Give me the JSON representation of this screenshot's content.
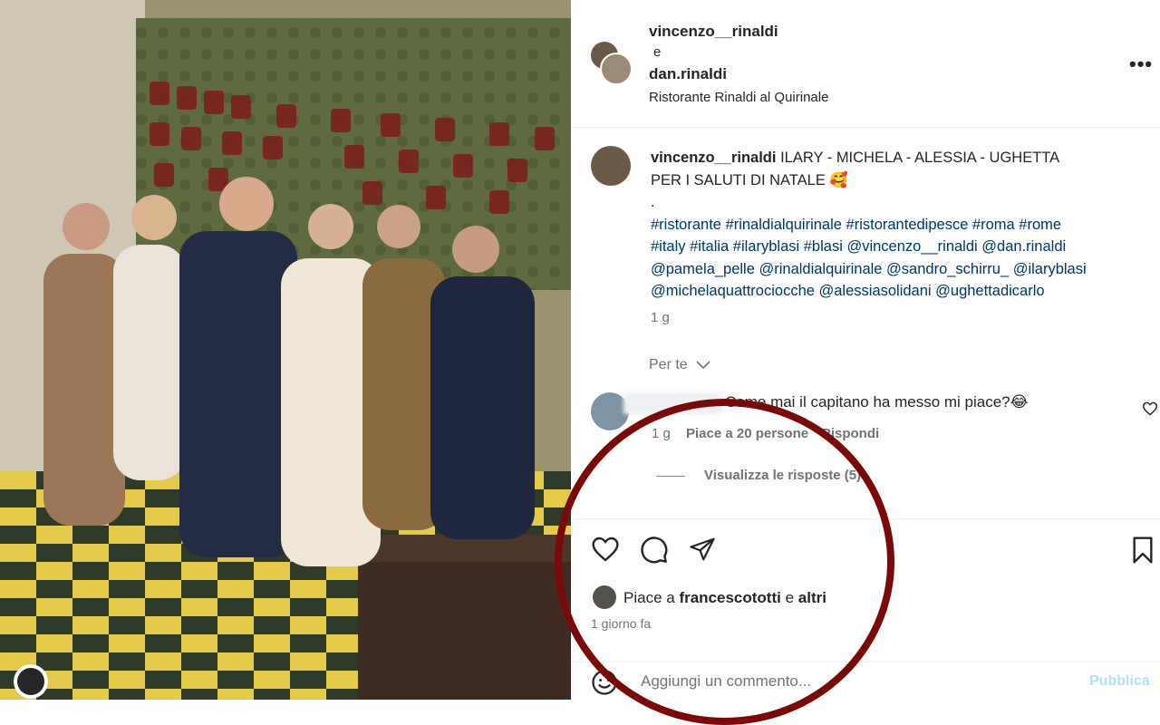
{
  "post": {
    "author1": "vincenzo__rinaldi",
    "joiner": "e",
    "author2": "dan.rinaldi",
    "location": "Ristorante Rinaldi al Quirinale",
    "more_label": "•••"
  },
  "caption": {
    "username": "vincenzo__rinaldi",
    "text_line1": "ILARY - MICHELA - ALESSIA - UGHETTA",
    "text_line2": "PER I SALUTI DI NATALE 🥰",
    "dot": ".",
    "hashtags_line1": "#ristorante #rinaldialquirinale #ristorantedipesce #roma #rome",
    "hashtags_line2": "#italy #italia #ilaryblasi #blasi @vincenzo__rinaldi @dan.rinaldi",
    "hashtags_line3": "@pamela_pelle @rinaldialquirinale @sandro_schirru_ @ilaryblasi",
    "hashtags_line4": "@michelaquattrociocche @alessiasolidani @ughettadicarlo",
    "time": "1 g"
  },
  "for_you": "Per te",
  "comment": {
    "text": "Come mai il capitano ha messo mi piace?😂",
    "time": "1 g",
    "likes": "Piace a 20 persone",
    "reply": "Rispondi",
    "view_replies": "Visualizza le risposte (5)"
  },
  "likes": {
    "prefix": "Piace a",
    "user": "francescototti",
    "conj": "e",
    "others": "altri"
  },
  "posted": "1 giorno fa",
  "add_comment": {
    "placeholder": "Aggiungi un commento...",
    "publish": "Pubblica"
  },
  "colors": {
    "link": "#00376b",
    "muted": "#737373",
    "highlight_circle": "#7a0a0a",
    "publish_disabled": "#b2dffc"
  },
  "icons": [
    "heart-icon",
    "comment-icon",
    "share-icon",
    "bookmark-icon",
    "emoji-icon",
    "chevron-down-icon",
    "more-icon"
  ]
}
